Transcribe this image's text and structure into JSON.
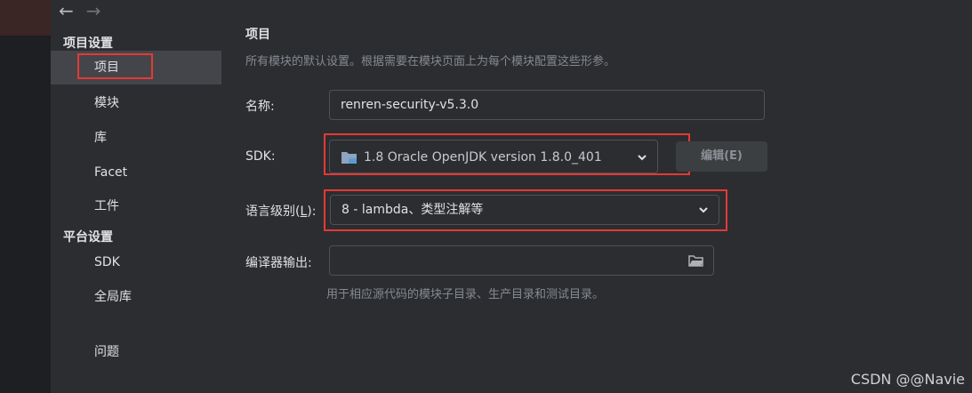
{
  "nav": {
    "back_glyph": "←",
    "forward_glyph": "→"
  },
  "sidebar": {
    "project_settings_header": "项目设置",
    "platform_settings_header": "平台设置",
    "items": [
      {
        "label": "项目"
      },
      {
        "label": "模块"
      },
      {
        "label": "库"
      },
      {
        "label": "Facet"
      },
      {
        "label": "工件"
      },
      {
        "label": "SDK"
      },
      {
        "label": "全局库"
      },
      {
        "label": "问题"
      }
    ]
  },
  "main": {
    "title": "项目",
    "subtitle": "所有模块的默认设置。根据需要在模块页面上为每个模块配置这些形参。",
    "name_label": "名称:",
    "name_value": "renren-security-v5.3.0",
    "sdk_label": "SDK:",
    "sdk_value": "1.8 Oracle OpenJDK version 1.8.0_401",
    "edit_button": "编辑(E)",
    "language_level_label_pre": "语言级别(",
    "language_level_label_mnemonic": "L",
    "language_level_label_post": "):",
    "language_level_value": "8 - lambda、类型注解等",
    "compiler_output_label": "编译器输出:",
    "compiler_output_value": "",
    "compiler_output_hint": "用于相应源代码的模块子目录、生产目录和测试目录。"
  },
  "watermark": "CSDN @@Navie",
  "colors": {
    "highlight": "#e53935",
    "selected_bg": "#43454a",
    "background": "#2b2d30"
  }
}
